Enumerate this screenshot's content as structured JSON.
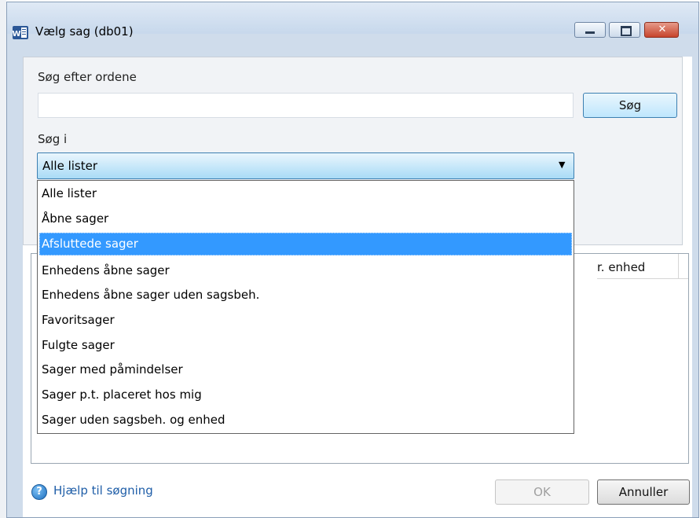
{
  "window": {
    "title": "Vælg sag (db01)",
    "close_glyph": "✕"
  },
  "search": {
    "label": "Søg efter ordene",
    "value": "",
    "button_label": "Søg"
  },
  "scope": {
    "label": "Søg i",
    "selected": "Alle lister",
    "arrow": "▼",
    "options": [
      "Alle lister",
      "Åbne sager",
      "Afsluttede sager",
      "Enhedens åbne sager",
      "Enhedens åbne sager uden sagsbeh.",
      "Favoritsager",
      "Fulgte sager",
      "Sager med påmindelser",
      "Sager p.t. placeret hos mig",
      "Sager uden sagsbeh. og enhed"
    ],
    "highlighted_option": "Afsluttede sager"
  },
  "results": {
    "visible_column_header": "r. enhed"
  },
  "footer": {
    "help_icon_glyph": "?",
    "help_link": "Hjælp til søgning",
    "ok_label": "OK",
    "cancel_label": "Annuller"
  },
  "colors": {
    "accent": "#3399ff",
    "link": "#1f5ea8",
    "titlebar": "#cfdceb"
  }
}
